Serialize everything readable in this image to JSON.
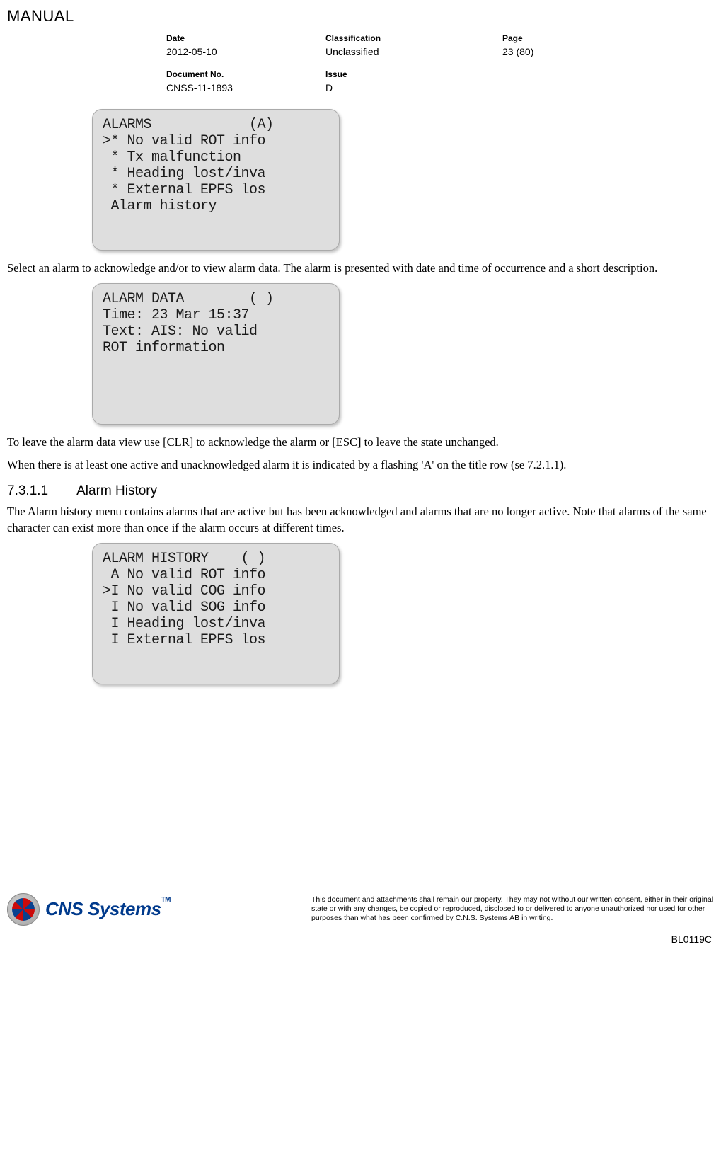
{
  "header": {
    "title": "MANUAL",
    "date_label": "Date",
    "date_value": "2012-05-10",
    "class_label": "Classification",
    "class_value": "Unclassified",
    "page_label": "Page",
    "page_value": "23 (80)",
    "docno_label": "Document No.",
    "docno_value": "CNSS-11-1893",
    "issue_label": "Issue",
    "issue_value": "D"
  },
  "screens": {
    "alarms": "ALARMS            (A)\n>* No valid ROT info\n * Tx malfunction\n * Heading lost/inva\n * External EPFS los\n Alarm history",
    "alarm_data": "ALARM DATA        ( )\nTime: 23 Mar 15:37\nText: AIS: No valid\nROT information",
    "alarm_history": "ALARM HISTORY    ( )\n A No valid ROT info\n>I No valid COG info\n I No valid SOG info\n I Heading lost/inva\n I External EPFS los"
  },
  "paragraphs": {
    "p1": "Select an alarm to acknowledge and/or to view alarm data. The alarm is presented with date and time of occurrence and a short description.",
    "p2": "To leave the alarm data view use [CLR] to acknowledge the alarm or [ESC] to leave the state unchanged.",
    "p3": "When there is at least one active and unacknowledged alarm it is indicated by a flashing 'A' on the title row (se 7.2.1.1).",
    "p4": "The Alarm history menu contains alarms that are active but has been acknowledged and alarms that are no longer active. Note that alarms of the same character can exist more than once if the alarm occurs at different times."
  },
  "section": {
    "num": "7.3.1.1",
    "title": "Alarm History"
  },
  "footer": {
    "company": "CNS Systems",
    "tm": "TM",
    "disclaimer": "This document and attachments shall remain our property. They may not without our written consent, either in their original state or with any changes, be copied or reproduced, disclosed to or delivered to anyone unauthorized nor used for other purposes than what has been confirmed by C.N.S. Systems AB in writing.",
    "code": "BL0119C"
  }
}
